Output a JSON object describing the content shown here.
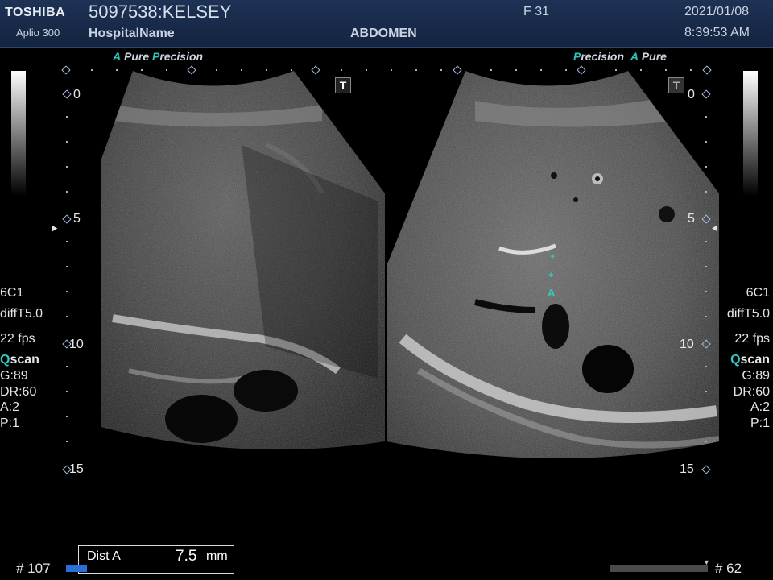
{
  "header": {
    "brand": "TOSHIBA",
    "model": "Aplio 300",
    "patient": "5097538:KELSEY",
    "hospital": "HospitalName",
    "preset": "ABDOMEN",
    "frame": "F  31",
    "date": "2021/01/08",
    "time": "8:39:53 AM"
  },
  "colors": {
    "header_bg": "#1b2e50",
    "accent": "#2fc3bd"
  },
  "left_image": {
    "proc_a": "A",
    "proc_pure": "Pure",
    "proc_p": "P",
    "proc_recision": "recision",
    "info": {
      "probe": "6C1",
      "mode": "diffT5.0",
      "fps": "22 fps",
      "q": "Q",
      "scan": "scan",
      "gain": "G:89",
      "dr": "DR:60",
      "a": "A:2",
      "p": "P:1"
    },
    "t_icon": "T"
  },
  "right_image": {
    "proc_p": "P",
    "proc_recision": "recision",
    "proc_a": "A",
    "proc_pure": "Pure",
    "info": {
      "probe": "6C1",
      "mode": "diffT5.0",
      "fps": "22 fps",
      "q": "Q",
      "scan": "scan",
      "gain": "G:89",
      "dr": "DR:60",
      "a": "A:2",
      "p": "P:1"
    },
    "t_icon": "T",
    "marker_label": "A"
  },
  "depth_scale": {
    "d0": "0",
    "d5": "5",
    "d10": "10",
    "d15": "15"
  },
  "measurement": {
    "label": "Dist A",
    "value": "7.5",
    "unit": "mm"
  },
  "footer": {
    "left_frame": "# 107",
    "right_frame": "# 62"
  },
  "icons": [
    "t-icon",
    "focus-arrow-icon",
    "caliper-icon"
  ]
}
